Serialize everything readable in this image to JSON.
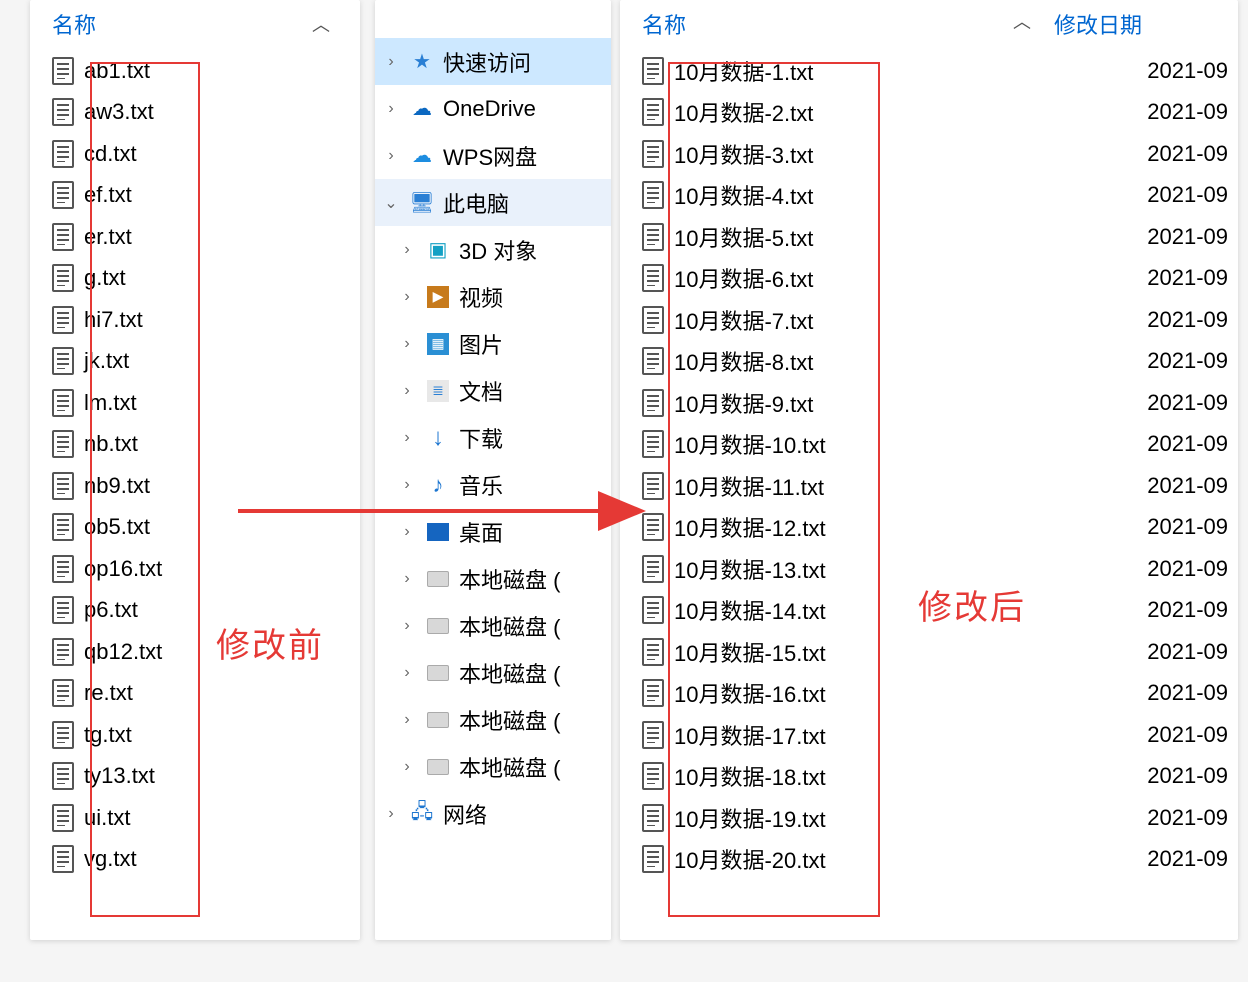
{
  "headers": {
    "name_left": "名称",
    "name_right": "名称",
    "date_right": "修改日期"
  },
  "labels": {
    "before": "修改前",
    "after": "修改后"
  },
  "nav": {
    "quick": "快速访问",
    "onedrive": "OneDrive",
    "wps": "WPS网盘",
    "pc": "此电脑",
    "objects3d": "3D 对象",
    "video": "视频",
    "pictures": "图片",
    "documents": "文档",
    "downloads": "下载",
    "music": "音乐",
    "desktop": "桌面",
    "disk": "本地磁盘 (",
    "network": "网络"
  },
  "before_files": [
    "ab1.txt",
    "aw3.txt",
    "cd.txt",
    "ef.txt",
    "er.txt",
    "g.txt",
    "hi7.txt",
    "jk.txt",
    "lm.txt",
    "nb.txt",
    "nb9.txt",
    "ob5.txt",
    "op16.txt",
    "p6.txt",
    "qb12.txt",
    "re.txt",
    "tg.txt",
    "ty13.txt",
    "ui.txt",
    "vg.txt"
  ],
  "after_files": [
    {
      "name": "10月数据-1.txt",
      "date": "2021-09"
    },
    {
      "name": "10月数据-2.txt",
      "date": "2021-09"
    },
    {
      "name": "10月数据-3.txt",
      "date": "2021-09"
    },
    {
      "name": "10月数据-4.txt",
      "date": "2021-09"
    },
    {
      "name": "10月数据-5.txt",
      "date": "2021-09"
    },
    {
      "name": "10月数据-6.txt",
      "date": "2021-09"
    },
    {
      "name": "10月数据-7.txt",
      "date": "2021-09"
    },
    {
      "name": "10月数据-8.txt",
      "date": "2021-09"
    },
    {
      "name": "10月数据-9.txt",
      "date": "2021-09"
    },
    {
      "name": "10月数据-10.txt",
      "date": "2021-09"
    },
    {
      "name": "10月数据-11.txt",
      "date": "2021-09"
    },
    {
      "name": "10月数据-12.txt",
      "date": "2021-09"
    },
    {
      "name": "10月数据-13.txt",
      "date": "2021-09"
    },
    {
      "name": "10月数据-14.txt",
      "date": "2021-09"
    },
    {
      "name": "10月数据-15.txt",
      "date": "2021-09"
    },
    {
      "name": "10月数据-16.txt",
      "date": "2021-09"
    },
    {
      "name": "10月数据-17.txt",
      "date": "2021-09"
    },
    {
      "name": "10月数据-18.txt",
      "date": "2021-09"
    },
    {
      "name": "10月数据-19.txt",
      "date": "2021-09"
    },
    {
      "name": "10月数据-20.txt",
      "date": "2021-09"
    }
  ]
}
